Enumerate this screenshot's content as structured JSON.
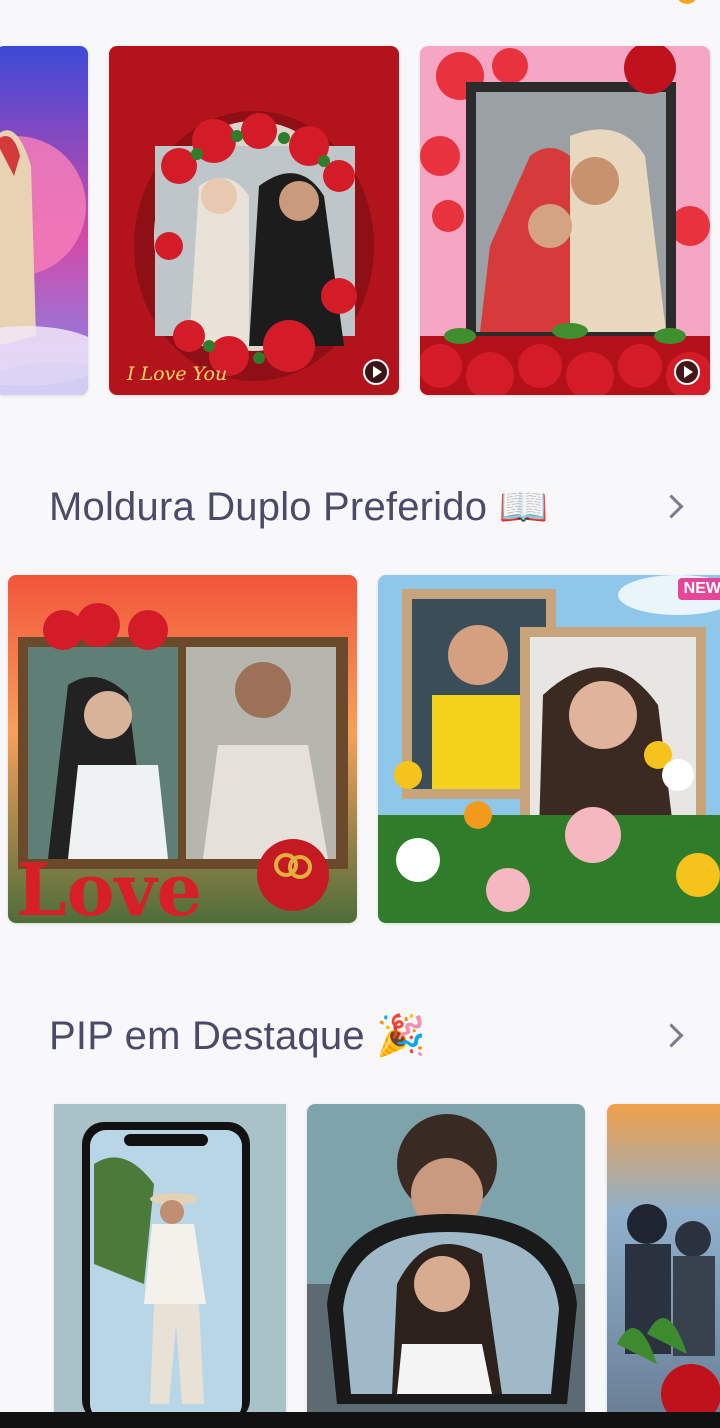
{
  "top_row": {
    "cards": [
      {
        "name": "pink-moon-frame"
      },
      {
        "name": "red-roses-oval-frame",
        "caption": "I Love You",
        "has_video": true
      },
      {
        "name": "hearts-roses-frame",
        "has_video": true
      }
    ]
  },
  "sections": [
    {
      "title": "Moldura Duplo Preferido 📖",
      "cards": [
        {
          "name": "love-book-frame"
        },
        {
          "name": "flower-double-frame",
          "badge": "NEW"
        }
      ]
    },
    {
      "title": "PIP em Destaque 🎉",
      "cards": [
        {
          "name": "phone-pip"
        },
        {
          "name": "car-mirror-pip"
        },
        {
          "name": "sunset-couple-pip"
        }
      ]
    }
  ],
  "colors": {
    "background": "#f8f8fa",
    "title_text": "#4a4a6a",
    "new_badge": "#e8459a"
  }
}
